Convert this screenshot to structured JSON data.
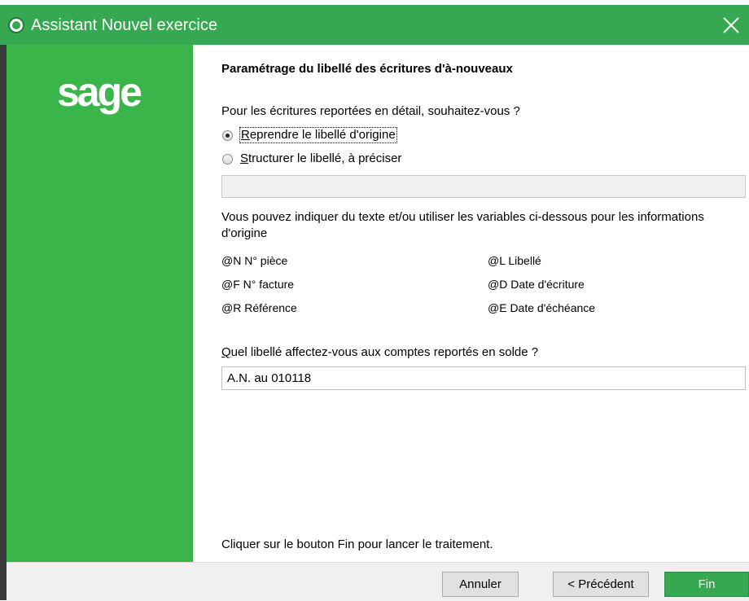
{
  "window": {
    "title": "Assistant Nouvel exercice",
    "app_icon": "sage-app-icon",
    "close_icon": "close-icon"
  },
  "sidebar": {
    "logo_text": "sage"
  },
  "main": {
    "heading": "Paramétrage du libellé des écritures d'à-nouveaux",
    "question1": "Pour les écritures reportées en détail, souhaitez-vous ?",
    "options": [
      {
        "label": "Reprendre le libellé d'origine",
        "checked": true
      },
      {
        "label": "Structurer le libellé, à préciser",
        "checked": false
      }
    ],
    "structure_input_value": "",
    "hint": "Vous pouvez indiquer du texte et/ou utiliser les variables ci-dessous pour les informations d'origine",
    "variables_left": [
      "@N N° pièce",
      "@F N° facture",
      "@R Référence"
    ],
    "variables_right": [
      "@L Libellé",
      "@D Date d'écriture",
      "@E Date d'échéance"
    ],
    "question2": "Quel libellé affectez-vous aux comptes reportés en solde ?",
    "solde_input_value": "A.N. au 010118",
    "footer": "Cliquer sur le bouton Fin pour lancer le traitement."
  },
  "buttons": {
    "cancel": "Annuler",
    "previous": "< Précédent",
    "finish": "Fin"
  },
  "colors": {
    "accent": "#36a852",
    "sidebar": "#3ab54a"
  }
}
